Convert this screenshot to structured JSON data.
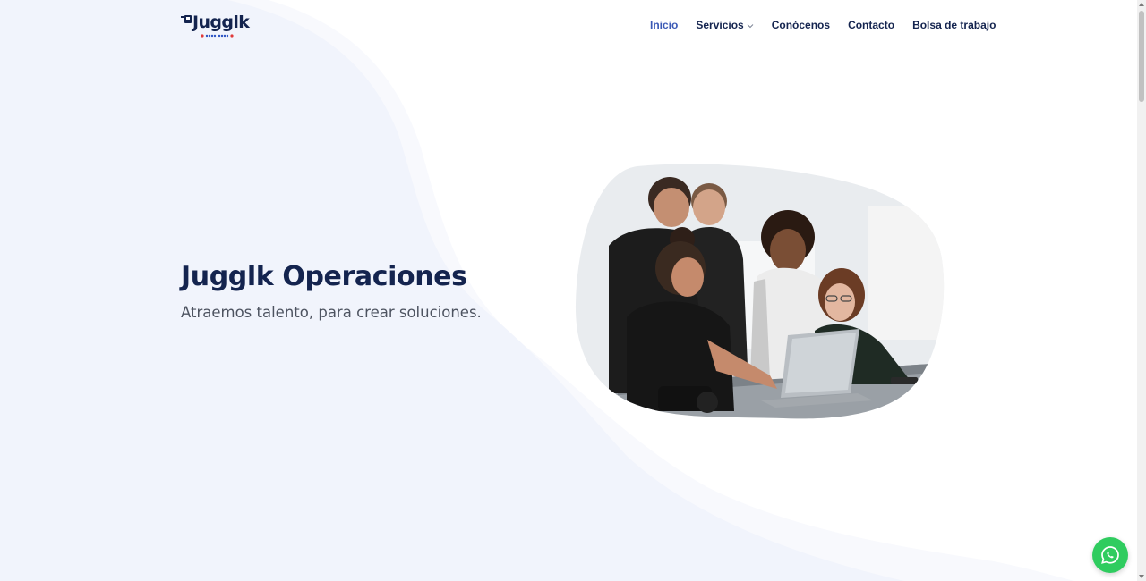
{
  "brand": {
    "name": "Jugglk",
    "colors": {
      "navy": "#14244f",
      "active": "#3c5ab6",
      "whatsapp": "#2fcc5f",
      "wave": "#eef2fa",
      "dot_blue": "#2e55c4",
      "dot_red": "#e03a3a"
    }
  },
  "nav": {
    "items": [
      {
        "label": "Inicio",
        "active": true
      },
      {
        "label": "Servicios",
        "has_dropdown": true
      },
      {
        "label": "Conócenos"
      },
      {
        "label": "Contacto"
      },
      {
        "label": "Bolsa de trabajo"
      }
    ]
  },
  "hero": {
    "title": "Jugglk Operaciones",
    "subtitle": "Atraemos talento, para crear soluciones."
  },
  "icons": {
    "dropdown": "chevron-down-icon",
    "whatsapp": "whatsapp-icon"
  }
}
